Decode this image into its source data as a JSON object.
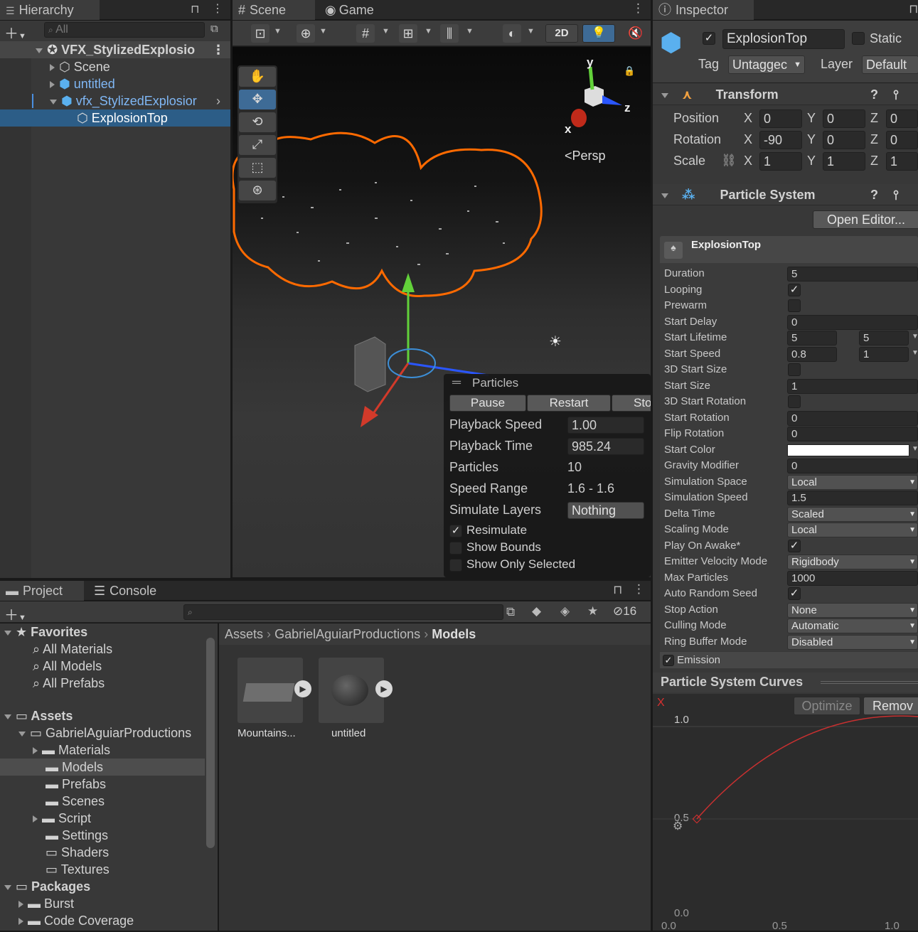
{
  "hierarchy": {
    "tab": "Hierarchy",
    "search_placeholder": "All",
    "root": "VFX_StylizedExplosio",
    "items": [
      "Scene",
      "untitled",
      "vfx_StylizedExplosior",
      "ExplosionTop"
    ]
  },
  "scene": {
    "tab_scene": "Scene",
    "tab_game": "Game",
    "btn_2d": "2D",
    "persp": "Persp",
    "axis_x": "x",
    "axis_y": "y",
    "axis_z": "z"
  },
  "particles_overlay": {
    "title": "Particles",
    "pause": "Pause",
    "restart": "Restart",
    "stop": "Sto",
    "rows": [
      {
        "label": "Playback Speed",
        "value": "1.00"
      },
      {
        "label": "Playback Time",
        "value": "985.24"
      },
      {
        "label": "Particles",
        "value": "10"
      },
      {
        "label": "Speed Range",
        "value": "1.6 - 1.6"
      },
      {
        "label": "Simulate Layers",
        "value": "Nothing"
      }
    ],
    "resimulate": "Resimulate",
    "show_bounds": "Show Bounds",
    "show_only_selected": "Show Only Selected"
  },
  "inspector": {
    "tab": "Inspector",
    "object_name": "ExplosionTop",
    "static": "Static",
    "tag_label": "Tag",
    "tag_value": "Untaggec",
    "layer_label": "Layer",
    "layer_value": "Default",
    "transform": {
      "title": "Transform",
      "position": {
        "label": "Position",
        "x": "0",
        "y": "0",
        "z": "0"
      },
      "rotation": {
        "label": "Rotation",
        "x": "-90",
        "y": "0",
        "z": "0"
      },
      "scale": {
        "label": "Scale",
        "x": "1",
        "y": "1",
        "z": "1"
      }
    },
    "particle_system": {
      "title": "Particle System",
      "open_editor": "Open Editor...",
      "module_name": "ExplosionTop",
      "rows": [
        {
          "label": "Duration",
          "kind": "field",
          "value": "5"
        },
        {
          "label": "Looping",
          "kind": "check",
          "checked": true
        },
        {
          "label": "Prewarm",
          "kind": "check",
          "checked": false
        },
        {
          "label": "Start Delay",
          "kind": "field",
          "value": "0"
        },
        {
          "label": "Start Lifetime",
          "kind": "pair",
          "value": "5",
          "value2": "5"
        },
        {
          "label": "Start Speed",
          "kind": "pair",
          "value": "0.8",
          "value2": "1"
        },
        {
          "label": "3D Start Size",
          "kind": "check",
          "checked": false
        },
        {
          "label": "Start Size",
          "kind": "field",
          "value": "1"
        },
        {
          "label": "3D Start Rotation",
          "kind": "check",
          "checked": false
        },
        {
          "label": "Start Rotation",
          "kind": "field",
          "value": "0"
        },
        {
          "label": "Flip Rotation",
          "kind": "field",
          "value": "0"
        },
        {
          "label": "Start Color",
          "kind": "color",
          "value": "#ffffff"
        },
        {
          "label": "Gravity Modifier",
          "kind": "field",
          "value": "0"
        },
        {
          "label": "Simulation Space",
          "kind": "drop",
          "value": "Local"
        },
        {
          "label": "Simulation Speed",
          "kind": "field",
          "value": "1.5"
        },
        {
          "label": "Delta Time",
          "kind": "drop",
          "value": "Scaled"
        },
        {
          "label": "Scaling Mode",
          "kind": "drop",
          "value": "Local"
        },
        {
          "label": "Play On Awake*",
          "kind": "check",
          "checked": true
        },
        {
          "label": "Emitter Velocity Mode",
          "kind": "drop",
          "value": "Rigidbody"
        },
        {
          "label": "Max Particles",
          "kind": "field",
          "value": "1000"
        },
        {
          "label": "Auto Random Seed",
          "kind": "check",
          "checked": true
        },
        {
          "label": "Stop Action",
          "kind": "drop",
          "value": "None"
        },
        {
          "label": "Culling Mode",
          "kind": "drop",
          "value": "Automatic"
        },
        {
          "label": "Ring Buffer Mode",
          "kind": "drop",
          "value": "Disabled"
        }
      ],
      "emission": "Emission"
    },
    "curves": {
      "title": "Particle System Curves",
      "optimize": "Optimize",
      "remove": "Remov",
      "x_marker": "X",
      "y_labels": [
        "1.0",
        "0.5",
        "0.0"
      ],
      "x_labels": [
        "0.0",
        "0.5",
        "1.0"
      ]
    }
  },
  "project": {
    "tab_project": "Project",
    "tab_console": "Console",
    "count": "16",
    "breadcrumb": [
      "Assets",
      "GabrielAguiarProductions",
      "Models"
    ],
    "favorites": {
      "title": "Favorites",
      "items": [
        "All Materials",
        "All Models",
        "All Prefabs"
      ]
    },
    "assets": {
      "title": "Assets",
      "root": "GabrielAguiarProductions",
      "folders": [
        "Materials",
        "Models",
        "Prefabs",
        "Scenes",
        "Script",
        "Settings",
        "Shaders",
        "Textures"
      ]
    },
    "packages": {
      "title": "Packages",
      "items": [
        "Burst",
        "Code Coverage"
      ]
    },
    "files": [
      "Mountains...",
      "untitled"
    ]
  }
}
